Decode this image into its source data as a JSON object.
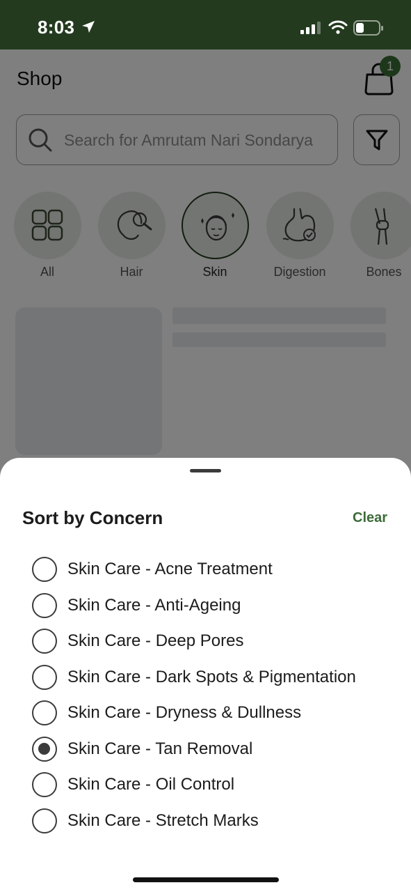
{
  "status_bar": {
    "time": "8:03"
  },
  "header": {
    "title": "Shop",
    "cart_count": "1"
  },
  "search": {
    "placeholder": "Search for Amrutam Nari Sondarya"
  },
  "categories": [
    {
      "label": "All",
      "icon": "grid-icon"
    },
    {
      "label": "Hair",
      "icon": "hair-icon"
    },
    {
      "label": "Skin",
      "icon": "skin-face-icon",
      "active": true
    },
    {
      "label": "Digestion",
      "icon": "stomach-icon"
    },
    {
      "label": "Bones",
      "icon": "knee-joint-icon"
    }
  ],
  "sheet": {
    "title": "Sort by Concern",
    "clear_label": "Clear",
    "options": [
      {
        "label": "Skin Care - Acne Treatment",
        "selected": false
      },
      {
        "label": "Skin Care - Anti-Ageing",
        "selected": false
      },
      {
        "label": "Skin Care - Deep Pores",
        "selected": false
      },
      {
        "label": "Skin Care - Dark Spots & Pigmentation",
        "selected": false
      },
      {
        "label": "Skin Care - Dryness & Dullness",
        "selected": false
      },
      {
        "label": "Skin Care - Tan Removal",
        "selected": true
      },
      {
        "label": "Skin Care - Oil Control",
        "selected": false
      },
      {
        "label": "Skin Care - Stretch Marks",
        "selected": false
      }
    ]
  },
  "colors": {
    "brand_dark": "#233a1e",
    "accent": "#3c6b38"
  }
}
